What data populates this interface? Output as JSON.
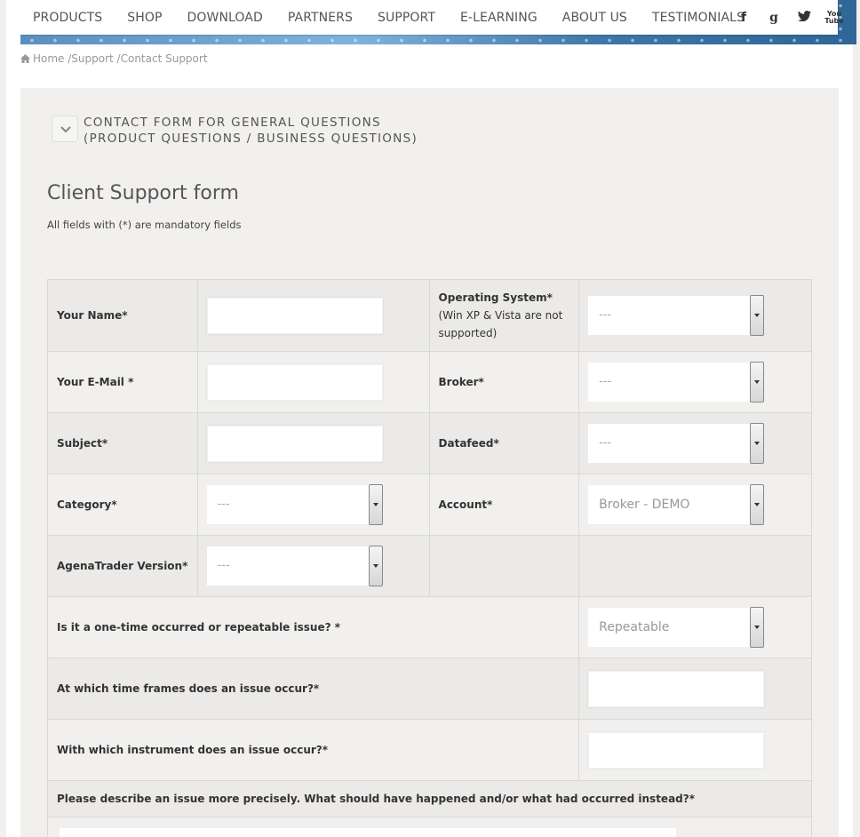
{
  "nav": {
    "items": [
      "PRODUCTS",
      "SHOP",
      "DOWNLOAD",
      "PARTNERS",
      "SUPPORT",
      "E-LEARNING",
      "ABOUT US",
      "TESTIMONIALS"
    ],
    "social": {
      "facebook": "f",
      "google": "g",
      "youtube_top": "You",
      "youtube_bottom": "Tube"
    }
  },
  "breadcrumb": {
    "home": "Home",
    "sep1": " /",
    "support": "Support",
    "sep2": " /",
    "current": "Contact Support"
  },
  "accordion": {
    "line1": "CONTACT FORM FOR GENERAL QUESTIONS",
    "line2": "(PRODUCT QUESTIONS / BUSINESS QUESTIONS)"
  },
  "form": {
    "title": "Client Support form",
    "mandatory_note": "All fields with (*) are mandatory fields",
    "labels": {
      "name": "Your Name*",
      "email": "Your E-Mail *",
      "subject": "Subject*",
      "category": "Category*",
      "version": "AgenaTrader Version*",
      "os": "Operating System*",
      "os_note": "(Win XP & Vista are not supported)",
      "broker": "Broker*",
      "datafeed": "Datafeed*",
      "account": "Account*",
      "repeatable": "Is it a one-time occurred or repeatable issue? *",
      "timeframes": "At which time frames does an issue occur?*",
      "instrument": "With which instrument does an issue occur?*",
      "describe": "Please describe an issue more precisely. What should have happened and/or what had occurred instead?*"
    },
    "values": {
      "os": "---",
      "broker": "---",
      "datafeed": "---",
      "category": "---",
      "account": "Broker - DEMO",
      "version": "---",
      "repeatable": "Repeatable"
    }
  }
}
